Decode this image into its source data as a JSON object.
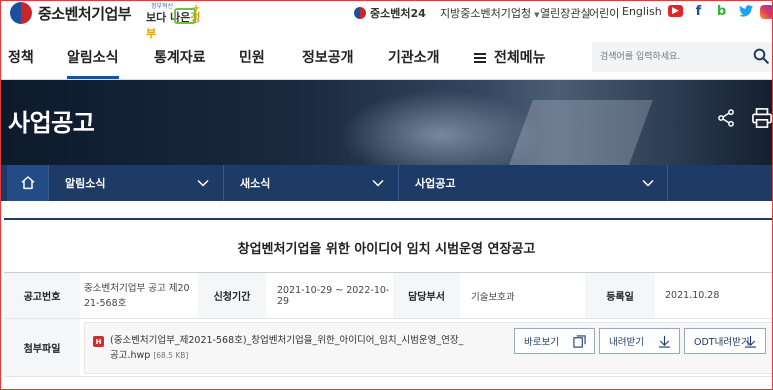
{
  "header": {
    "org_name": "중소벤처기업부",
    "slogan_small": "정부혁신",
    "slogan_main_left": "보다 나은",
    "slogan_main_right": "정부",
    "util": {
      "sbiz24": "중소벤처24",
      "region": "지방중소벤처기업청",
      "open_office": "열린장관실",
      "kids": "어린이",
      "english": "English"
    },
    "sns": [
      "youtube-icon",
      "facebook-icon",
      "blog-icon",
      "twitter-icon",
      "instagram-icon"
    ]
  },
  "gnb": {
    "items": [
      "정책",
      "알림소식",
      "통계자료",
      "민원",
      "정보공개",
      "기관소개"
    ],
    "all_menu": "전체메뉴",
    "search_placeholder": "검색어를 입력하세요."
  },
  "banner": {
    "title": "사업공고"
  },
  "location": {
    "segments": [
      "알림소식",
      "새소식",
      "사업공고"
    ]
  },
  "post": {
    "title": "창업벤처기업을 위한 아이디어 임치 시범운영 연장공고",
    "rows": {
      "notice_no_label": "공고번호",
      "notice_no_line1": "중소벤처기업부 공고 제20",
      "notice_no_line2": "21-568호",
      "period_label": "신청기간",
      "period_value": "2021-10-29 ~ 2022-10-29",
      "dept_label": "담당부서",
      "dept_value": "기술보호과",
      "reg_label": "등록일",
      "reg_value": "2021.10.28",
      "attach_label": "첨부파일"
    },
    "attachment": {
      "type_badge": "H",
      "name_line1": "(중소벤처기업부_제2021-568호)_창업벤처기업을_위한_아이디어_임치_시범운영_연장_",
      "name_line2": "공고.hwp",
      "size": "[68.5 KB]",
      "buttons": [
        "바로보기",
        "내려받기",
        "ODT내려받기"
      ]
    }
  },
  "colors": {
    "navy": "#1e3a66",
    "accent_blue": "#1b4fa0",
    "banner_dark": "#0d1a2c"
  }
}
